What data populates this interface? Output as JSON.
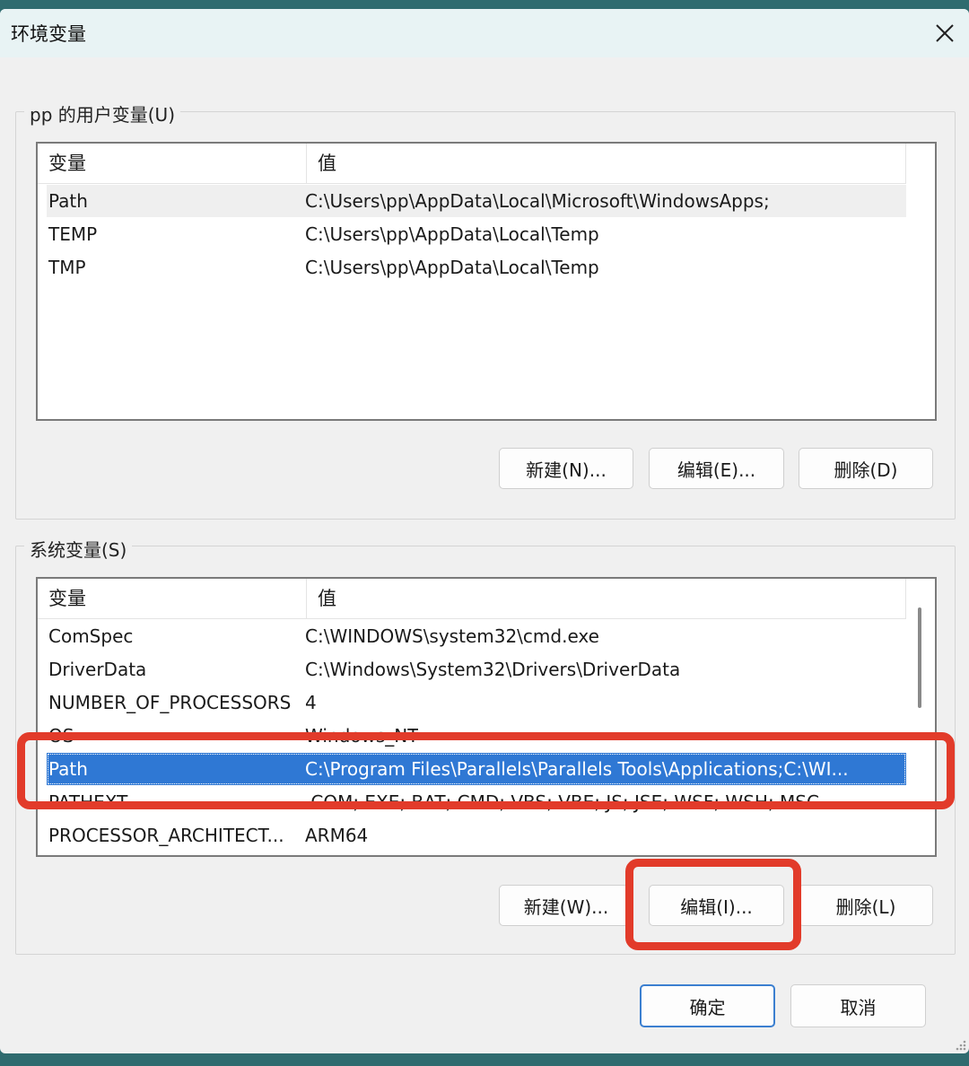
{
  "window": {
    "title": "环境变量"
  },
  "user_vars": {
    "group_label": "pp 的用户变量(U)",
    "columns": [
      "变量",
      "值"
    ],
    "rows": [
      {
        "name": "Path",
        "value": "C:\\Users\\pp\\AppData\\Local\\Microsoft\\WindowsApps;"
      },
      {
        "name": "TEMP",
        "value": "C:\\Users\\pp\\AppData\\Local\\Temp"
      },
      {
        "name": "TMP",
        "value": "C:\\Users\\pp\\AppData\\Local\\Temp"
      }
    ],
    "buttons": {
      "new": "新建(N)...",
      "edit": "编辑(E)...",
      "delete": "删除(D)"
    }
  },
  "system_vars": {
    "group_label": "系统变量(S)",
    "columns": [
      "变量",
      "值"
    ],
    "rows": [
      {
        "name": "ComSpec",
        "value": "C:\\WINDOWS\\system32\\cmd.exe"
      },
      {
        "name": "DriverData",
        "value": "C:\\Windows\\System32\\Drivers\\DriverData"
      },
      {
        "name": "NUMBER_OF_PROCESSORS",
        "value": "4"
      },
      {
        "name": "OS",
        "value": "Windows_NT"
      },
      {
        "name": "Path",
        "value": "C:\\Program Files\\Parallels\\Parallels Tools\\Applications;C:\\WI..."
      },
      {
        "name": "PATHEXT",
        "value": ".COM;.EXE;.BAT;.CMD;.VBS;.VBE;.JS;.JSE;.WSF;.WSH;.MSC"
      },
      {
        "name": "PROCESSOR_ARCHITECT...",
        "value": "ARM64"
      }
    ],
    "buttons": {
      "new": "新建(W)...",
      "edit": "编辑(I)...",
      "delete": "删除(L)"
    }
  },
  "footer": {
    "ok": "确定",
    "cancel": "取消"
  },
  "colors": {
    "selection": "#2f78d4",
    "annotation": "#e23b2a",
    "primary_border": "#3b7fd0"
  }
}
